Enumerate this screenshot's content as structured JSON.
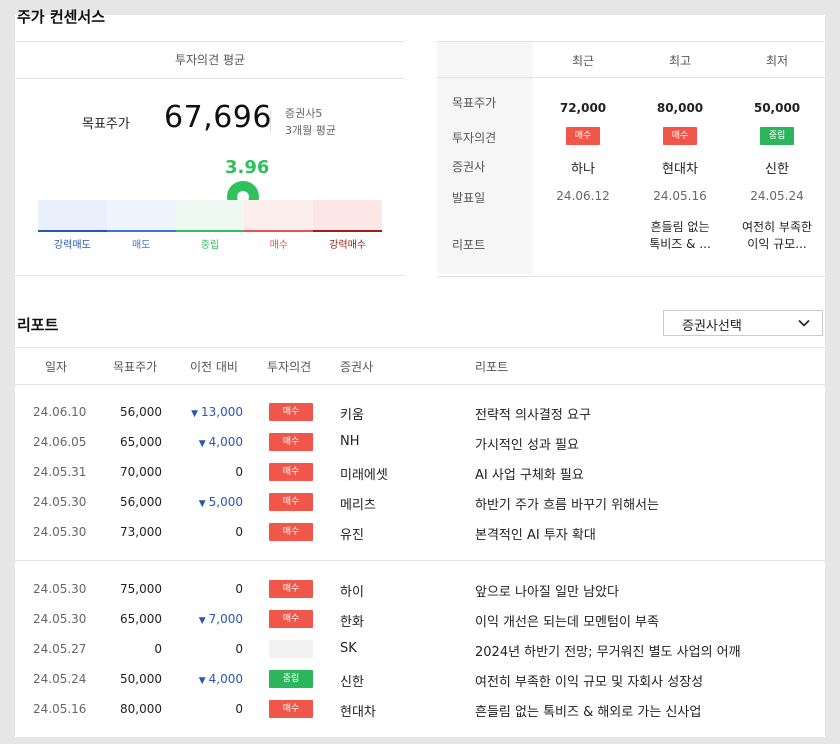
{
  "title": "주가 컨센서스",
  "consensus": {
    "header": "투자의견 평균",
    "target_label": "목표주가",
    "target_value": "67,696",
    "broker_count": "증권사5",
    "period": "3개월 평균",
    "score": "3.96",
    "gauge_labels": [
      "강력매도",
      "매도",
      "중립",
      "매수",
      "강력매수"
    ],
    "gauge_colors": [
      "#2757b5",
      "#3c74d4",
      "#2fc25b",
      "#e2564b",
      "#a11c1c"
    ]
  },
  "summary": {
    "columns": [
      "최근",
      "최고",
      "최저"
    ],
    "row_labels": [
      "목표주가",
      "투자의견",
      "증권사",
      "발표일",
      "리포트"
    ],
    "recent": {
      "price": "72,000",
      "opinion": "매수",
      "broker": "하나",
      "date": "24.06.12",
      "report": ""
    },
    "high": {
      "price": "80,000",
      "opinion": "매수",
      "broker": "현대차",
      "date": "24.05.16",
      "report_l1": "흔들림 없는",
      "report_l2": "톡비즈 & ..."
    },
    "low": {
      "price": "50,000",
      "opinion": "중립",
      "broker": "신한",
      "date": "24.05.24",
      "report_l1": "여전히 부족한",
      "report_l2": "이익 규모..."
    }
  },
  "reports": {
    "title": "리포트",
    "select_label": "증권사선택",
    "headers": [
      "일자",
      "목표주가",
      "이전 대비",
      "투자의견",
      "증권사",
      "리포트"
    ],
    "rows": [
      {
        "date": "24.06.10",
        "price": "56,000",
        "diff": "13,000",
        "dir": "down",
        "opinion": "매수",
        "broker": "키움",
        "report": "전략적 의사결정 요구"
      },
      {
        "date": "24.06.05",
        "price": "65,000",
        "diff": "4,000",
        "dir": "down",
        "opinion": "매수",
        "broker": "NH",
        "report": "가시적인 성과 필요"
      },
      {
        "date": "24.05.31",
        "price": "70,000",
        "diff": "0",
        "dir": "none",
        "opinion": "매수",
        "broker": "미래에셋",
        "report": "AI 사업 구체화 필요"
      },
      {
        "date": "24.05.30",
        "price": "56,000",
        "diff": "5,000",
        "dir": "down",
        "opinion": "매수",
        "broker": "메리츠",
        "report": "하반기 주가 흐름 바꾸기 위해서는"
      },
      {
        "date": "24.05.30",
        "price": "73,000",
        "diff": "0",
        "dir": "none",
        "opinion": "매수",
        "broker": "유진",
        "report": "본격적인 AI 투자 확대"
      },
      {
        "date": "24.05.30",
        "price": "75,000",
        "diff": "0",
        "dir": "none",
        "opinion": "매수",
        "broker": "하이",
        "report": "앞으로 나아질 일만 남았다"
      },
      {
        "date": "24.05.30",
        "price": "65,000",
        "diff": "7,000",
        "dir": "down",
        "opinion": "매수",
        "broker": "한화",
        "report": "이익 개선은 되는데 모멘텀이 부족"
      },
      {
        "date": "24.05.27",
        "price": "0",
        "diff": "0",
        "dir": "none",
        "opinion": "",
        "broker": "SK",
        "report": "2024년 하반기 전망; 무거워진 별도 사업의 어깨"
      },
      {
        "date": "24.05.24",
        "price": "50,000",
        "diff": "4,000",
        "dir": "down",
        "opinion": "중립",
        "broker": "신한",
        "report": "여전히 부족한 이익 규모 및 자회사 성장성"
      },
      {
        "date": "24.05.16",
        "price": "80,000",
        "diff": "0",
        "dir": "none",
        "opinion": "매수",
        "broker": "현대차",
        "report": "흔들림 없는 톡비즈 & 해외로 가는 신사업"
      }
    ]
  },
  "colors": {
    "buy": "#f0564a",
    "hold": "#2db55d",
    "down": "#2757b5",
    "score": "#2fc25b"
  }
}
